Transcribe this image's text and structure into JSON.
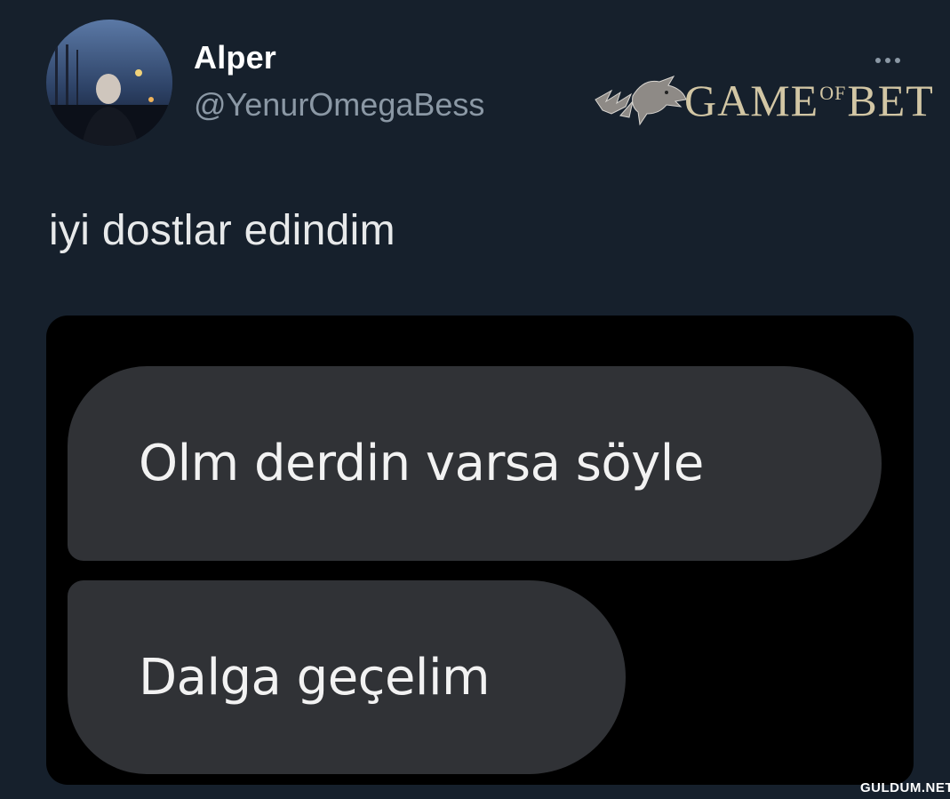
{
  "tweet": {
    "author": {
      "display_name": "Alper",
      "handle": "@YenurOmegaBess"
    },
    "more_icon": "more-horizontal-icon",
    "text": "iyi dostlar edindim",
    "media": {
      "messages": [
        "Olm derdin varsa söyle",
        "Dalga geçelim"
      ]
    }
  },
  "watermarks": {
    "logo": "GAMEOFBET",
    "site": "GULDUM.NET"
  },
  "colors": {
    "background": "#16202c",
    "secondary_text": "#8b98a5",
    "bubble": "#303236",
    "logo_gold": "#d2c6a4"
  }
}
